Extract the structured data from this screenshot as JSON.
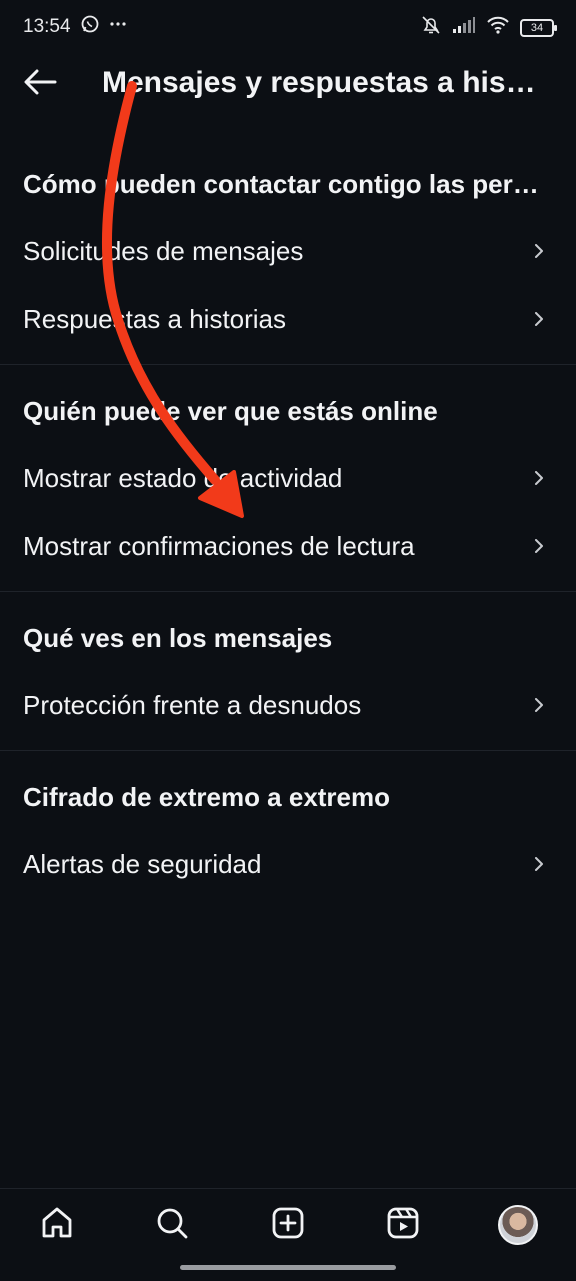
{
  "status_bar": {
    "time": "13:54",
    "battery": "34",
    "icons": [
      "whatsapp-icon",
      "more-dots-icon",
      "bell-off-icon",
      "signal-icon",
      "wifi-icon",
      "battery-icon"
    ]
  },
  "header": {
    "title": "Mensajes y respuestas a historias",
    "back_icon": "arrow-left-icon"
  },
  "sections": [
    {
      "heading": "Cómo pueden contactar contigo las personas",
      "items": [
        {
          "label": "Solicitudes de mensajes"
        },
        {
          "label": "Respuestas a historias"
        }
      ]
    },
    {
      "heading": "Quién puede ver que estás online",
      "items": [
        {
          "label": "Mostrar estado de actividad"
        },
        {
          "label": "Mostrar confirmaciones de lectura"
        }
      ]
    },
    {
      "heading": "Qué ves en los mensajes",
      "items": [
        {
          "label": "Protección frente a desnudos"
        }
      ]
    },
    {
      "heading": "Cifrado de extremo a extremo",
      "items": [
        {
          "label": "Alertas de seguridad"
        }
      ]
    }
  ],
  "bottom_nav": [
    "home-icon",
    "search-icon",
    "create-icon",
    "reels-icon",
    "profile-avatar"
  ],
  "colors": {
    "background": "#0c0f14",
    "text": "#f2f3f5",
    "annotation_arrow": "#f23a1a"
  }
}
